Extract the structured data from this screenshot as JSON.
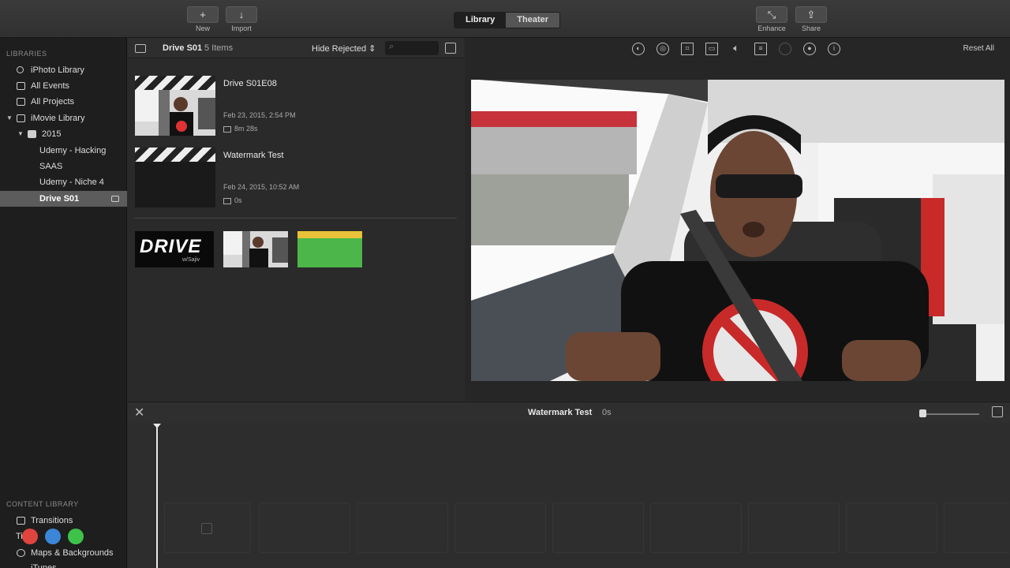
{
  "toolbar": {
    "new_label": "New",
    "import_label": "Import",
    "tabs": [
      {
        "label": "Library",
        "active": true
      },
      {
        "label": "Theater",
        "active": false
      }
    ],
    "enhance_label": "Enhance",
    "share_label": "Share"
  },
  "sidebar": {
    "libraries_header": "LIBRARIES",
    "items": [
      {
        "label": "iPhoto Library",
        "icon": "star-icon"
      },
      {
        "label": "All Events",
        "icon": "events-icon"
      },
      {
        "label": "All Projects",
        "icon": "projects-icon"
      },
      {
        "label": "iMovie Library",
        "icon": "library-icon"
      },
      {
        "label": "2015",
        "icon": "folder-icon"
      },
      {
        "label": "Udemy - Hacking",
        "icon": ""
      },
      {
        "label": "SAAS",
        "icon": ""
      },
      {
        "label": "Udemy - Niche 4",
        "icon": ""
      },
      {
        "label": "Drive S01",
        "icon": "",
        "selected": true
      }
    ],
    "content_header": "CONTENT LIBRARY",
    "content_items": [
      {
        "label": "Transitions",
        "icon": "transitions-icon"
      },
      {
        "label": "Titles",
        "icon": "titles-icon"
      },
      {
        "label": "Maps & Backgrounds",
        "icon": "globe-icon"
      },
      {
        "label": "iTunes",
        "icon": "music-icon"
      }
    ]
  },
  "browser": {
    "title": "Drive S01",
    "count": "5 Items",
    "filter": "Hide Rejected",
    "clips": [
      {
        "title": "Drive S01E08",
        "date": "Feb 23, 2015, 2:54 PM",
        "duration": "8m 28s"
      },
      {
        "title": "Watermark Test",
        "date": "Feb 24, 2015, 10:52 AM",
        "duration": "0s"
      }
    ],
    "drive_logo_text": "DRIVE",
    "drive_logo_sub": "w/Sajiv"
  },
  "viewer": {
    "reset_label": "Reset All"
  },
  "timeline": {
    "title": "Watermark Test",
    "duration": "0s"
  },
  "colors": {
    "close": "#e0443e",
    "minimize": "#3b86d8",
    "zoom": "#3ec24a",
    "green_clip": "#4cb64a",
    "yellow_strip": "#e9c23a"
  }
}
